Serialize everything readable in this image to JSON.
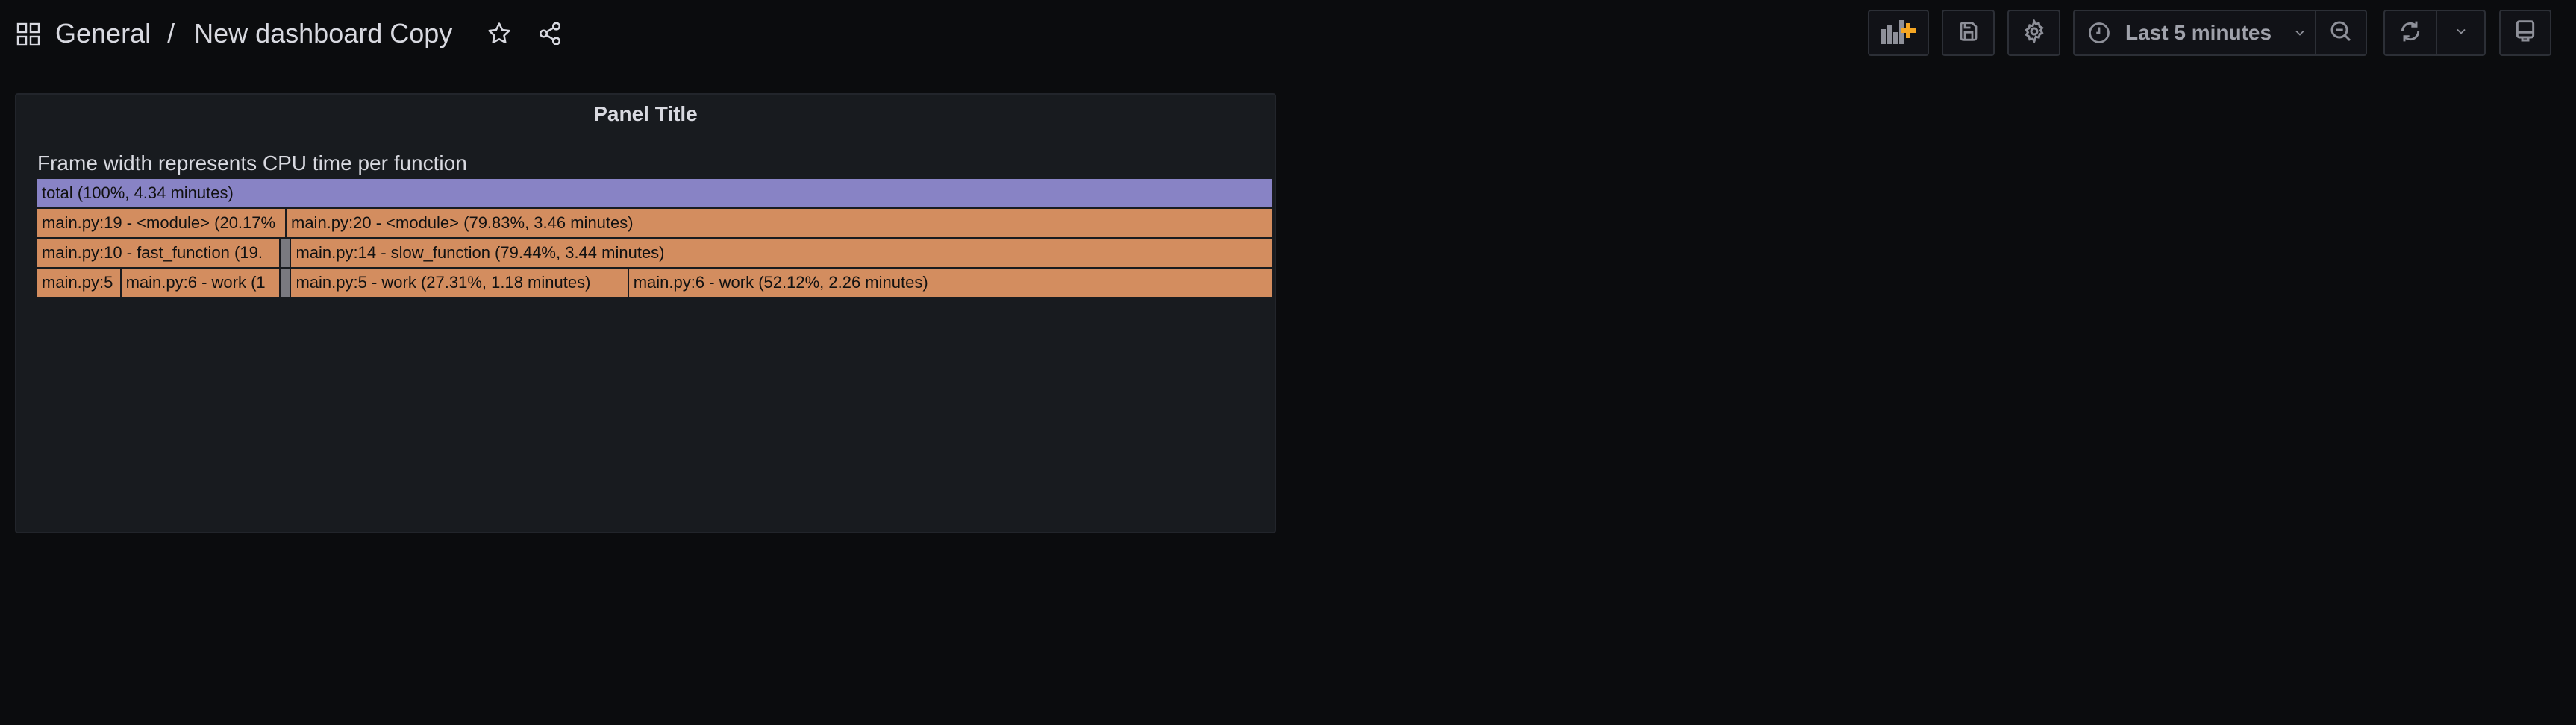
{
  "header": {
    "breadcrumb_folder": "General",
    "breadcrumb_separator": "/",
    "dashboard_title": "New dashboard Copy",
    "icons": [
      "apps-icon",
      "star-icon",
      "share-icon"
    ]
  },
  "toolbar": {
    "time_range": "Last 5 minutes",
    "accent_color": "#f5a623",
    "buttons": [
      "add-panel",
      "save-dashboard",
      "settings",
      "time-picker",
      "zoom-out",
      "refresh",
      "refresh-interval",
      "tv-mode"
    ]
  },
  "panel": {
    "title": "Panel Title",
    "description": "Frame width represents CPU time per function",
    "colors": {
      "root": "#8883c5",
      "frame": "#d38d5f",
      "collapsed": "#7a7a80"
    },
    "frames": [
      {
        "label": "total (100%, 4.34 minutes)",
        "level": 0,
        "start_pct": 0,
        "width_pct": 100,
        "kind": "root"
      },
      {
        "label": "main.py:19 - <module> (20.17%",
        "level": 1,
        "start_pct": 0,
        "width_pct": 20.17,
        "kind": "frame"
      },
      {
        "label": "main.py:20 - <module> (79.83%, 3.46 minutes)",
        "level": 1,
        "start_pct": 20.17,
        "width_pct": 79.83,
        "kind": "frame"
      },
      {
        "label": "main.py:10 - fast_function (19.",
        "level": 2,
        "start_pct": 0,
        "width_pct": 19.7,
        "kind": "frame"
      },
      {
        "label": "",
        "level": 2,
        "start_pct": 19.7,
        "width_pct": 0.86,
        "kind": "collapsed"
      },
      {
        "label": "main.py:14 - slow_function (79.44%, 3.44 minutes)",
        "level": 2,
        "start_pct": 20.56,
        "width_pct": 79.44,
        "kind": "frame"
      },
      {
        "label": "main.py:5",
        "level": 3,
        "start_pct": 0,
        "width_pct": 6.8,
        "kind": "frame"
      },
      {
        "label": "main.py:6 - work (1",
        "level": 3,
        "start_pct": 6.8,
        "width_pct": 12.9,
        "kind": "frame"
      },
      {
        "label": "",
        "level": 3,
        "start_pct": 19.7,
        "width_pct": 0.86,
        "kind": "collapsed"
      },
      {
        "label": "main.py:5 - work (27.31%, 1.18 minutes)",
        "level": 3,
        "start_pct": 20.56,
        "width_pct": 27.31,
        "kind": "frame"
      },
      {
        "label": "main.py:6 - work (52.12%, 2.26 minutes)",
        "level": 3,
        "start_pct": 47.87,
        "width_pct": 52.13,
        "kind": "frame"
      }
    ]
  }
}
